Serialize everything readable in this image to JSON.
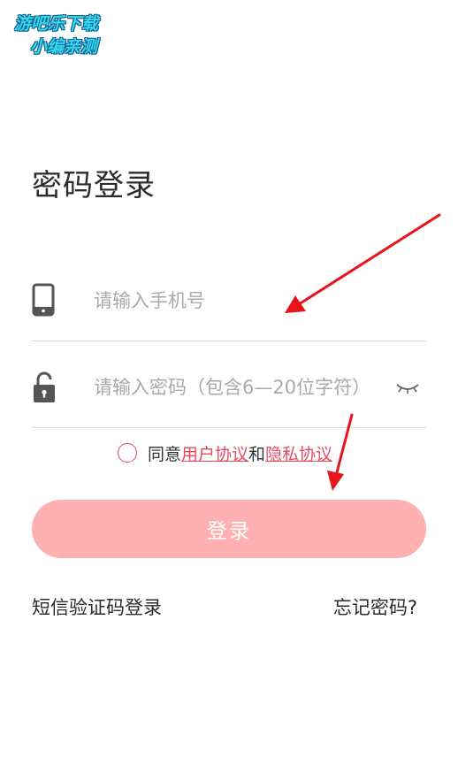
{
  "watermark": {
    "line1": "游吧乐下载",
    "line2": "小编亲测"
  },
  "page": {
    "title": "密码登录"
  },
  "phone_field": {
    "icon": "phone-icon",
    "placeholder": "请输入手机号",
    "value": ""
  },
  "password_field": {
    "icon": "lock-icon",
    "placeholder": "请输入密码（包含6—20位字符）",
    "value": "",
    "toggle_icon": "eye-closed-icon"
  },
  "agreement": {
    "prefix": "同意",
    "user_agreement": "用户协议",
    "and": "和",
    "privacy_policy": "隐私协议"
  },
  "login_button": {
    "label": "登录"
  },
  "links": {
    "sms_login": "短信验证码登录",
    "forgot_password": "忘记密码?"
  },
  "colors": {
    "accent": "#e84a5f",
    "button_bg": "#ffb1b1",
    "annotation_arrow": "#e8141c",
    "icon": "#555555"
  }
}
